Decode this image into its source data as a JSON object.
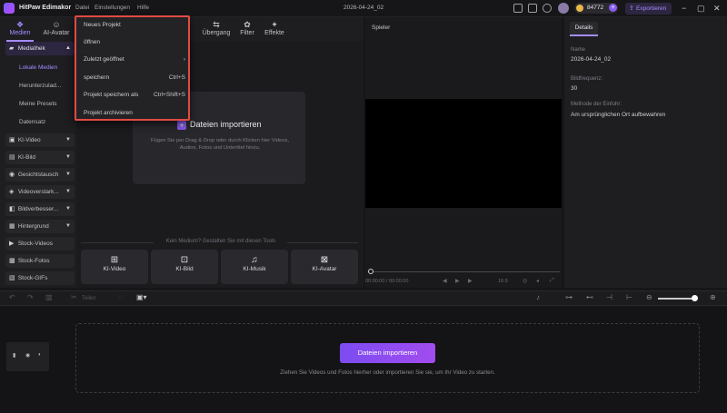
{
  "titlebar": {
    "app_name": "HitPaw Edimakor",
    "menu": [
      "Datei",
      "Einstellungen",
      "Hilfe"
    ],
    "project_title": "2026-04-24_02",
    "coins": "84772",
    "export_label": "Exportieren"
  },
  "top_tabs": [
    {
      "label": "Medien",
      "icon": "media-icon"
    },
    {
      "label": "AI-Avatar",
      "icon": "avatar-icon"
    },
    {
      "label": "Übergang",
      "icon": "transition-icon"
    },
    {
      "label": "Filter",
      "icon": "filter-icon"
    },
    {
      "label": "Effekte",
      "icon": "effects-icon"
    }
  ],
  "sidebar": {
    "library_label": "Mediathek",
    "sub_items": [
      "Lokale Medien",
      "Herunterzulad...",
      "Meine Presets",
      "Datensatz"
    ],
    "items": [
      "KI-Video",
      "KI-Bild",
      "Gesichtstausch",
      "Videoverstark...",
      "Bildverbesser...",
      "Hintergrund",
      "Stock-Videos",
      "Stock-Fotos",
      "Stock-GIFs"
    ]
  },
  "media": {
    "import_title": "Dateien importieren",
    "import_desc": "Fügen Sie per Drag & Drop oder durch Klicken hier Videos, Audios, Fotos und Untertitel hinzu.",
    "tools_title": "Kein Medium? Gestalten Sie mit diesen Tools",
    "tools": [
      "KI-Video",
      "KI-Bild",
      "KI-Musik",
      "KI-Avatar"
    ]
  },
  "dropdown": {
    "items": [
      {
        "label": "Neues Projekt",
        "shortcut": ""
      },
      {
        "label": "öffnen",
        "shortcut": ""
      },
      {
        "label": "Zuletzt geöffnet",
        "shortcut": "›"
      },
      {
        "label": "speichern",
        "shortcut": "Ctrl+S"
      },
      {
        "label": "Projekt speichern als",
        "shortcut": "Ctrl+Shift+S"
      },
      {
        "label": "Projekt archivieren",
        "shortcut": ""
      }
    ]
  },
  "player": {
    "label": "Spieler",
    "time": "00:00:00 / 00:00:00",
    "ratio": "16:9"
  },
  "details": {
    "tab": "Details",
    "name_label": "Name",
    "name_value": "2026-04-24_02",
    "fps_label": "Bildfrequenz:",
    "fps_value": "30",
    "method_label": "Methode der Einfuhr:",
    "method_value": "Am ursprünglichen Ort aufbewahren"
  },
  "timeline": {
    "split_label": "Teilen",
    "import_button": "Dateien importieren",
    "hint": "Ziehen Sie Videos und Fotos hierher oder importieren Sie sie, um Ihr Video zu starten."
  }
}
